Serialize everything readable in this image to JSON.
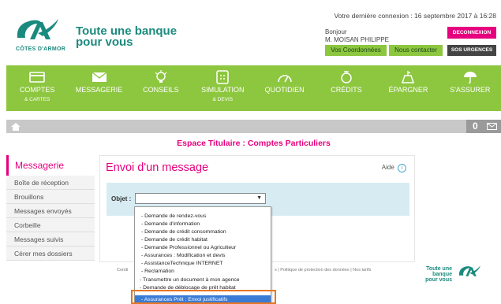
{
  "header": {
    "tagline_line1": "Toute une banque",
    "tagline_line2": "pour vous",
    "region": "CÔTES D'ARMOR",
    "last_connection": "Votre dernière connexion : 16 septembre 2017 à 16:28",
    "greeting": "Bonjour",
    "user_name": "M. MOISAN PHILIPPE",
    "logout_label": "DECONNEXION",
    "coordonnees_label": "Vos Coordonnées",
    "contact_label": "Nous contacter",
    "sos_label": "SOS URGENCES"
  },
  "nav": {
    "items": [
      {
        "label": "COMPTES",
        "sub": "& CARTES",
        "icon": "card-icon"
      },
      {
        "label": "MESSAGERIE",
        "sub": "",
        "icon": "envelope-icon"
      },
      {
        "label": "CONSEILS",
        "sub": "",
        "icon": "lightbulb-icon"
      },
      {
        "label": "SIMULATION",
        "sub": "& DEVIS",
        "icon": "calculator-icon"
      },
      {
        "label": "QUOTIDIEN",
        "sub": "",
        "icon": "gauge-icon"
      },
      {
        "label": "CRÉDITS",
        "sub": "",
        "icon": "hand-icon"
      },
      {
        "label": "ÉPARGNER",
        "sub": "",
        "icon": "piggy-icon"
      },
      {
        "label": "S'ASSURER",
        "sub": "",
        "icon": "umbrella-icon"
      }
    ]
  },
  "greybar": {
    "message_count": "0"
  },
  "espace_title": "Espace Titulaire : Comptes Particuliers",
  "sidebar": {
    "title": "Messagerie",
    "items": [
      "Boîte de réception",
      "Brouillons",
      "Messages envoyés",
      "Corbeille",
      "Messages suivis",
      "Cérer mes dossiers"
    ]
  },
  "main": {
    "title": "Envoi d'un message",
    "help_label": "Aide",
    "objet_label": "Objet :",
    "select_value": "",
    "options": [
      "- Demande de rendez-vous",
      "- Demande d'information",
      "- Demande de crédit consommation",
      "- Demande de crédit habitat",
      "- Demande Professionnel ou Agriculteur",
      "- Assurances : Modification et devis",
      "- AssistanceTechnique INTERNET",
      "- Reclamation",
      "- Transmettre un document à mon agence",
      "- Demande de déblocage de prêt habitat"
    ],
    "selected_option": "- Assurances Prêt : Envoi justificatifs"
  },
  "footer": {
    "links_left": "Condi",
    "links_right": "s | Politique de protection des données | Nos tarifs",
    "tagline_line1": "Toute une banque",
    "tagline_line2": "pour vous"
  },
  "colors": {
    "brand_green": "#8dc63f",
    "brand_teal": "#1b8a7e",
    "accent_pink": "#e6007e",
    "highlight_orange": "#e87722"
  }
}
